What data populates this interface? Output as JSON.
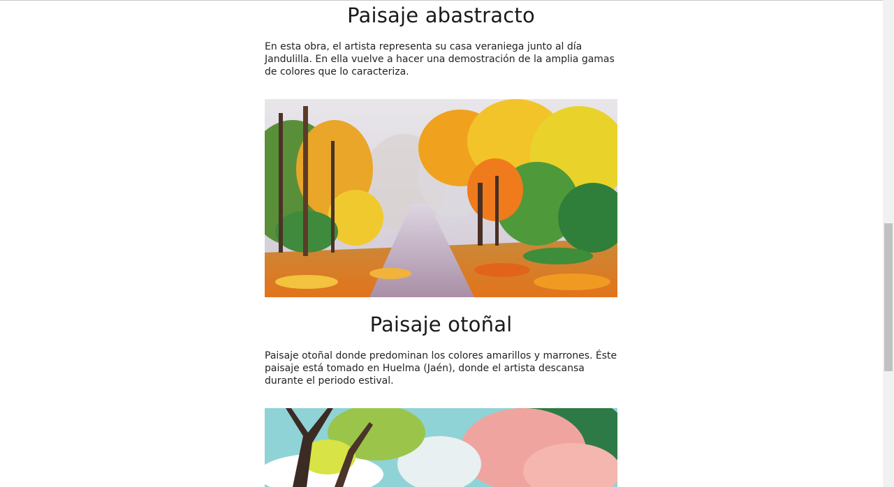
{
  "sections": [
    {
      "title": "Paisaje abastracto",
      "description": "En esta obra, el artista representa su casa veraniega junto al día Jandulilla. En ella vuelve a hacer una demostración de la amplia gamas de colores que lo caracteriza.",
      "image_subject": "autumn-forest-path-painting"
    },
    {
      "title": "Paisaje otoñal",
      "description": "Paisaje otoñal donde predominan los colores amarillos y marrones. Éste paisaje está tomado en Huelma (Jaén), donde el artista descansa durante el periodo estival.",
      "image_subject": "spring-blossom-trees-painting"
    }
  ],
  "colors": {
    "text": "#222222",
    "background": "#ffffff",
    "scrollbar_track": "#f1f1f1",
    "scrollbar_thumb": "#c1c1c1"
  }
}
